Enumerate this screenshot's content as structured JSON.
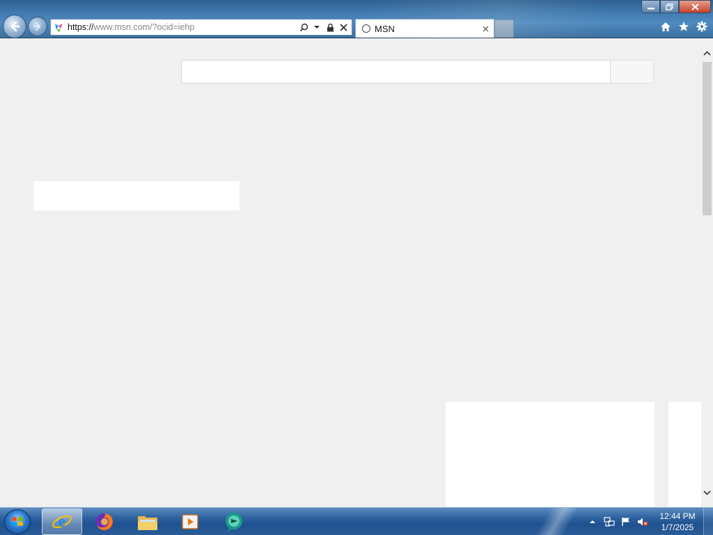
{
  "browser": {
    "address": {
      "url_protocol": "https://",
      "url_rest": "www.msn.com/?ocid=iehp"
    },
    "tab": {
      "title": "MSN"
    }
  },
  "taskbar": {
    "apps": [
      {
        "name": "Internet Explorer",
        "icon": "ie-icon",
        "active": true
      },
      {
        "name": "Firefox",
        "icon": "firefox-icon",
        "active": false
      },
      {
        "name": "Windows Explorer",
        "icon": "folder-icon",
        "active": false
      },
      {
        "name": "Media Player",
        "icon": "media-player-icon",
        "active": false
      },
      {
        "name": "App",
        "icon": "chat-app-icon",
        "active": false
      }
    ],
    "clock": {
      "time": "12:44 PM",
      "date": "1/7/2025"
    }
  },
  "colors": {
    "page_background": "#f0f0f0",
    "titlebar": "#3f78ad",
    "taskbar": "#1f5190",
    "close_button": "#c8412a"
  }
}
